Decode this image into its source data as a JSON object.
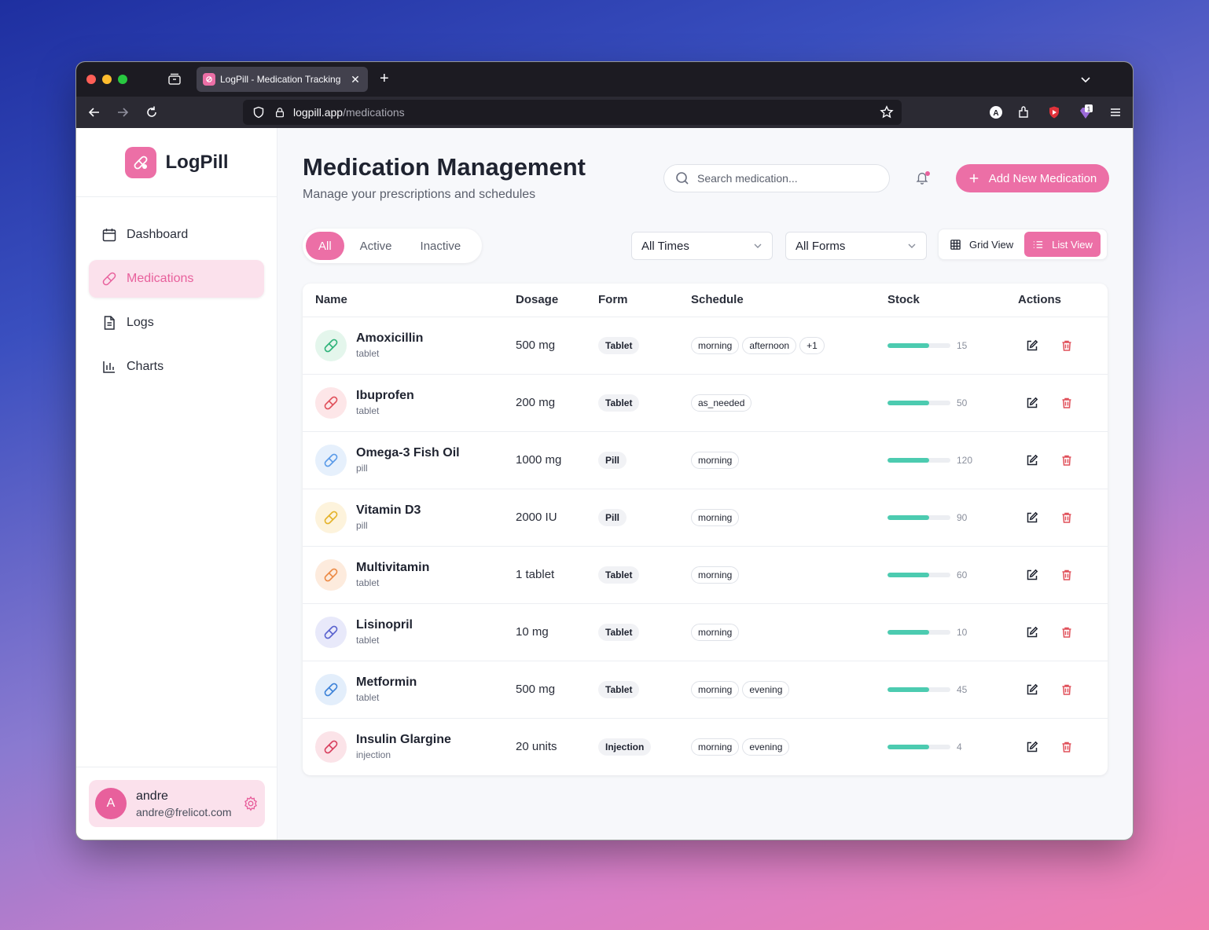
{
  "browser": {
    "tab_title": "LogPill - Medication Tracking",
    "url_host": "logpill.app",
    "url_path": "/medications",
    "extension_badge": "1"
  },
  "sidebar": {
    "brand": "LogPill",
    "items": [
      {
        "label": "Dashboard",
        "icon": "calendar-icon"
      },
      {
        "label": "Medications",
        "icon": "pill-icon"
      },
      {
        "label": "Logs",
        "icon": "document-icon"
      },
      {
        "label": "Charts",
        "icon": "bar-chart-icon"
      }
    ],
    "user": {
      "initial": "A",
      "name": "andre",
      "email": "andre@frelicot.com"
    }
  },
  "header": {
    "title": "Medication Management",
    "subtitle": "Manage your prescriptions and schedules",
    "search_placeholder": "Search medication...",
    "add_button": "Add New Medication"
  },
  "filters": {
    "status_tabs": [
      "All",
      "Active",
      "Inactive"
    ],
    "time_select": "All Times",
    "form_select": "All Forms",
    "grid_view": "Grid View",
    "list_view": "List View"
  },
  "table": {
    "columns": [
      "Name",
      "Dosage",
      "Form",
      "Schedule",
      "Stock",
      "Actions"
    ],
    "rows": [
      {
        "name": "Amoxicillin",
        "sub": "tablet",
        "dosage": "500 mg",
        "form": "Tablet",
        "schedule": [
          "morning",
          "afternoon",
          "+1"
        ],
        "stock": "15",
        "color": "#2fb37a",
        "bg": "#e4f6ec"
      },
      {
        "name": "Ibuprofen",
        "sub": "tablet",
        "dosage": "200 mg",
        "form": "Tablet",
        "schedule": [
          "as_needed"
        ],
        "stock": "50",
        "color": "#e0505a",
        "bg": "#fde6e8"
      },
      {
        "name": "Omega-3 Fish Oil",
        "sub": "pill",
        "dosage": "1000 mg",
        "form": "Pill",
        "schedule": [
          "morning"
        ],
        "stock": "120",
        "color": "#5b9be8",
        "bg": "#e6f0fc"
      },
      {
        "name": "Vitamin D3",
        "sub": "pill",
        "dosage": "2000 IU",
        "form": "Pill",
        "schedule": [
          "morning"
        ],
        "stock": "90",
        "color": "#e5b32a",
        "bg": "#fdf3dc"
      },
      {
        "name": "Multivitamin",
        "sub": "tablet",
        "dosage": "1 tablet",
        "form": "Tablet",
        "schedule": [
          "morning"
        ],
        "stock": "60",
        "color": "#ec8a45",
        "bg": "#fdebdd"
      },
      {
        "name": "Lisinopril",
        "sub": "tablet",
        "dosage": "10 mg",
        "form": "Tablet",
        "schedule": [
          "morning"
        ],
        "stock": "10",
        "color": "#5a63cf",
        "bg": "#e8e9fa"
      },
      {
        "name": "Metformin",
        "sub": "tablet",
        "dosage": "500 mg",
        "form": "Tablet",
        "schedule": [
          "morning",
          "evening"
        ],
        "stock": "45",
        "color": "#3d82d8",
        "bg": "#e3eefb"
      },
      {
        "name": "Insulin Glargine",
        "sub": "injection",
        "dosage": "20 units",
        "form": "Injection",
        "schedule": [
          "morning",
          "evening"
        ],
        "stock": "4",
        "color": "#d8405f",
        "bg": "#fbe3e8"
      }
    ]
  },
  "colors": {
    "accent": "#ec6fa6",
    "stock_bar": "#4ccbb0",
    "delete": "#e0505a"
  }
}
